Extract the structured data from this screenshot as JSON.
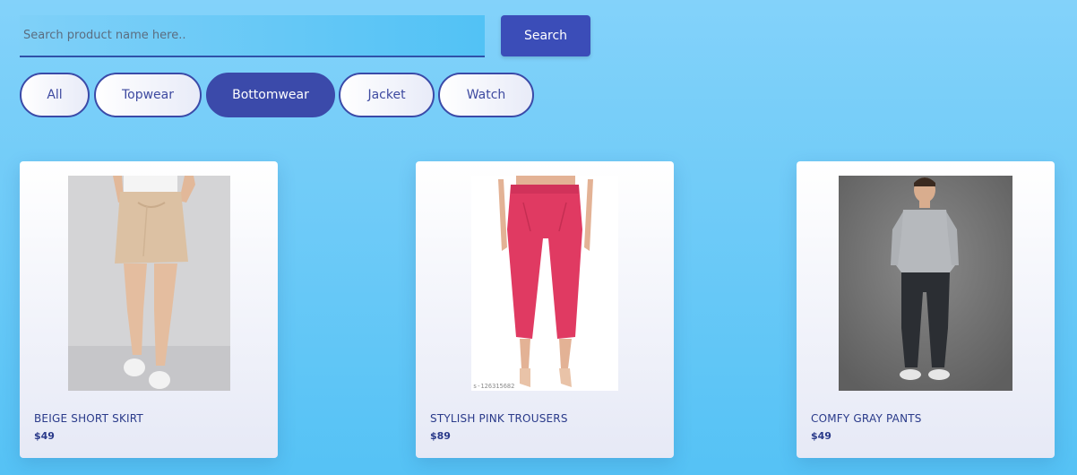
{
  "search": {
    "placeholder": "Search product name here..",
    "value": "",
    "button_label": "Search"
  },
  "filters": [
    {
      "label": "All",
      "active": false
    },
    {
      "label": "Topwear",
      "active": false
    },
    {
      "label": "Bottomwear",
      "active": true
    },
    {
      "label": "Jacket",
      "active": false
    },
    {
      "label": "Watch",
      "active": false
    }
  ],
  "products": [
    {
      "name": "BEIGE SHORT SKIRT",
      "price": "$49"
    },
    {
      "name": "STYLISH PINK TROUSERS",
      "price": "$89",
      "image_watermark": "s-126315682"
    },
    {
      "name": "COMFY GRAY PANTS",
      "price": "$49"
    }
  ],
  "colors": {
    "accent": "#3b4aaa",
    "text": "#2a3a8a",
    "background": "#6ccbf7"
  }
}
